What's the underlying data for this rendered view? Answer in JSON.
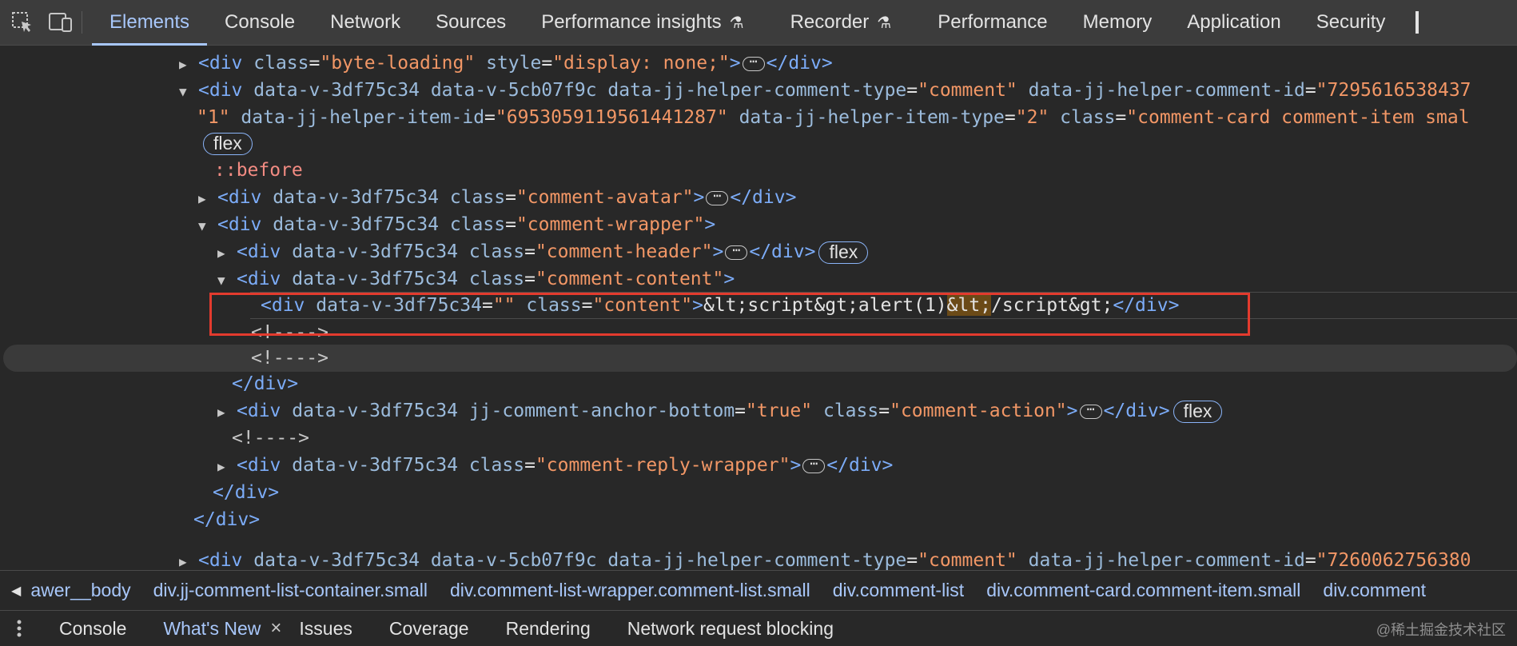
{
  "toolbar": {
    "tabs": [
      {
        "label": "Elements",
        "active": true
      },
      {
        "label": "Console"
      },
      {
        "label": "Network"
      },
      {
        "label": "Sources"
      },
      {
        "label": "Performance insights",
        "experimental": true
      },
      {
        "label": "Recorder",
        "experimental": true
      },
      {
        "label": "Performance"
      },
      {
        "label": "Memory"
      },
      {
        "label": "Application"
      },
      {
        "label": "Security"
      }
    ]
  },
  "dom": {
    "l1_attr1": "class",
    "l1_val1": "\"byte-loading\"",
    "l1_attr2": "style",
    "l1_val2": "\"display: none;\"",
    "l2_a1": "data-v-3df75c34",
    "l2_a2": "data-v-5cb07f9c",
    "l2_a3": "data-jj-helper-comment-type",
    "l2_v3": "\"comment\"",
    "l2_a4": "data-jj-helper-comment-id",
    "l2_v4": "\"7295616538437",
    "l3_v0": "\"1\"",
    "l3_a1": "data-jj-helper-item-id",
    "l3_v1": "\"6953059119561441287\"",
    "l3_a2": "data-jj-helper-item-type",
    "l3_v2": "\"2\"",
    "l3_a3": "class",
    "l3_v3": "\"comment-card comment-item smal",
    "flex": "flex",
    "before": "::before",
    "dv": "data-v-3df75c34",
    "cls": "class",
    "avatar": "\"comment-avatar\"",
    "wrapper": "\"comment-wrapper\"",
    "header": "\"comment-header\"",
    "content": "\"comment-content\"",
    "sel_attr": "data-v-3df75c34",
    "sel_val": "\"\"",
    "sel_cls_val": "\"content\"",
    "sel_text1": "&lt;script&gt;alert(1)",
    "sel_text2": "&lt;",
    "sel_text3": "/script&gt;",
    "comment": "<!---->",
    "anchor_attr": "jj-comment-anchor-bottom",
    "anchor_val": "\"true\"",
    "action": "\"comment-action\"",
    "reply": "\"comment-reply-wrapper\"",
    "last_a4v": "\"7260062756380"
  },
  "breadcrumbs": {
    "items": [
      "awer__body",
      "div.jj-comment-list-container.small",
      "div.comment-list-wrapper.comment-list.small",
      "div.comment-list",
      "div.comment-card.comment-item.small",
      "div.comment"
    ]
  },
  "drawer": {
    "tabs": [
      {
        "label": "Console"
      },
      {
        "label": "What's New",
        "active": true
      },
      {
        "label": "Issues"
      },
      {
        "label": "Coverage"
      },
      {
        "label": "Rendering"
      },
      {
        "label": "Network request blocking"
      }
    ],
    "watermark": "@稀土掘金技术社区"
  }
}
